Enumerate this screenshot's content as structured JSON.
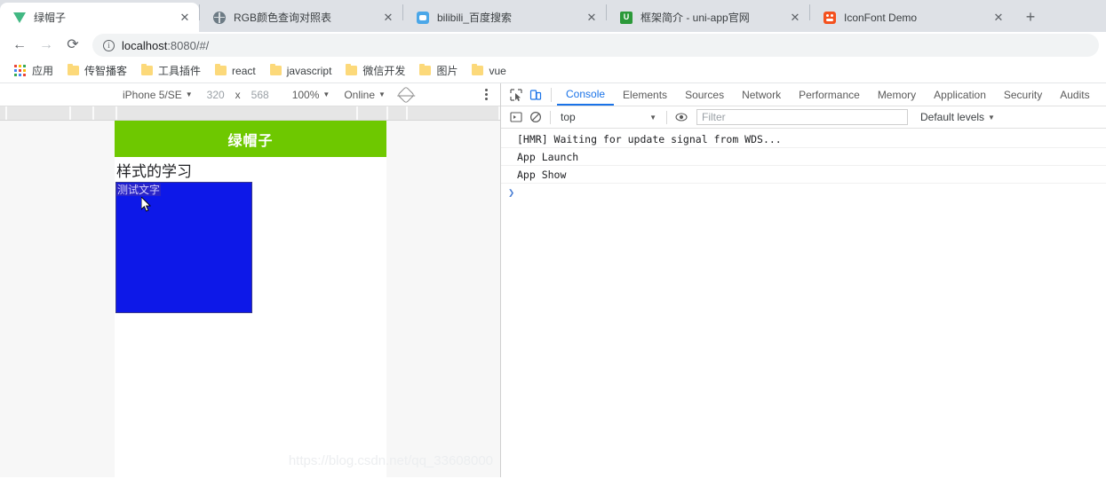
{
  "tabs": [
    {
      "title": "绿帽子",
      "favicon": "vue-logo-icon",
      "active": true,
      "close": "✕"
    },
    {
      "title": "RGB颜色查询对照表",
      "favicon": "globe-icon",
      "active": false,
      "close": "✕"
    },
    {
      "title": "bilibili_百度搜索",
      "favicon": "baidu-icon",
      "active": false,
      "close": "✕"
    },
    {
      "title": "框架简介 - uni-app官网",
      "favicon": "uniapp-icon",
      "active": false,
      "close": "✕"
    },
    {
      "title": "IconFont Demo",
      "favicon": "iconfont-icon",
      "active": false,
      "close": "✕"
    }
  ],
  "newtab_label": "+",
  "toolbar": {
    "back": "←",
    "forward": "→",
    "reload": "⟳",
    "info_icon": "ⓘ",
    "url_main": "localhost",
    "url_rest": ":8080/#/"
  },
  "bookmarks": [
    {
      "label": "应用",
      "icon": "apps-grid-icon"
    },
    {
      "label": "传智播客",
      "icon": "folder-icon"
    },
    {
      "label": "工具插件",
      "icon": "folder-icon"
    },
    {
      "label": "react",
      "icon": "folder-icon"
    },
    {
      "label": "javascript",
      "icon": "folder-icon"
    },
    {
      "label": "微信开发",
      "icon": "folder-icon"
    },
    {
      "label": "图片",
      "icon": "folder-icon"
    },
    {
      "label": "vue",
      "icon": "folder-icon"
    }
  ],
  "device_toolbar": {
    "device": "iPhone 5/SE",
    "width": "320",
    "times": "x",
    "height": "568",
    "zoom": "100%",
    "network": "Online",
    "rotate_icon": "rotate-icon",
    "menu_icon": "kebab-menu-icon",
    "caret": "▼"
  },
  "page": {
    "header_title": "绿帽子",
    "heading": "样式的学习",
    "box_text": "测试文字",
    "green": "#6ec800",
    "blue": "#0d18e8"
  },
  "watermark": "https://blog.csdn.net/qq_33608000",
  "devtools": {
    "inspect_icon": "inspect-cursor-icon",
    "device_toggle_icon": "device-toolbar-icon",
    "tabs": [
      {
        "label": "Console",
        "active": true
      },
      {
        "label": "Elements",
        "active": false
      },
      {
        "label": "Sources",
        "active": false
      },
      {
        "label": "Network",
        "active": false
      },
      {
        "label": "Performance",
        "active": false
      },
      {
        "label": "Memory",
        "active": false
      },
      {
        "label": "Application",
        "active": false
      },
      {
        "label": "Security",
        "active": false
      },
      {
        "label": "Audits",
        "active": false
      }
    ],
    "console_toolbar": {
      "sidebar_icon": "console-sidebar-icon",
      "clear_icon": "clear-console-icon",
      "context": "top",
      "caret": "▼",
      "eye_icon": "live-expression-icon",
      "filter_placeholder": "Filter",
      "levels": "Default levels",
      "levels_caret": "▼"
    },
    "messages": [
      "[HMR] Waiting for update signal from WDS...",
      "App Launch",
      "App Show"
    ],
    "prompt": "❯"
  }
}
